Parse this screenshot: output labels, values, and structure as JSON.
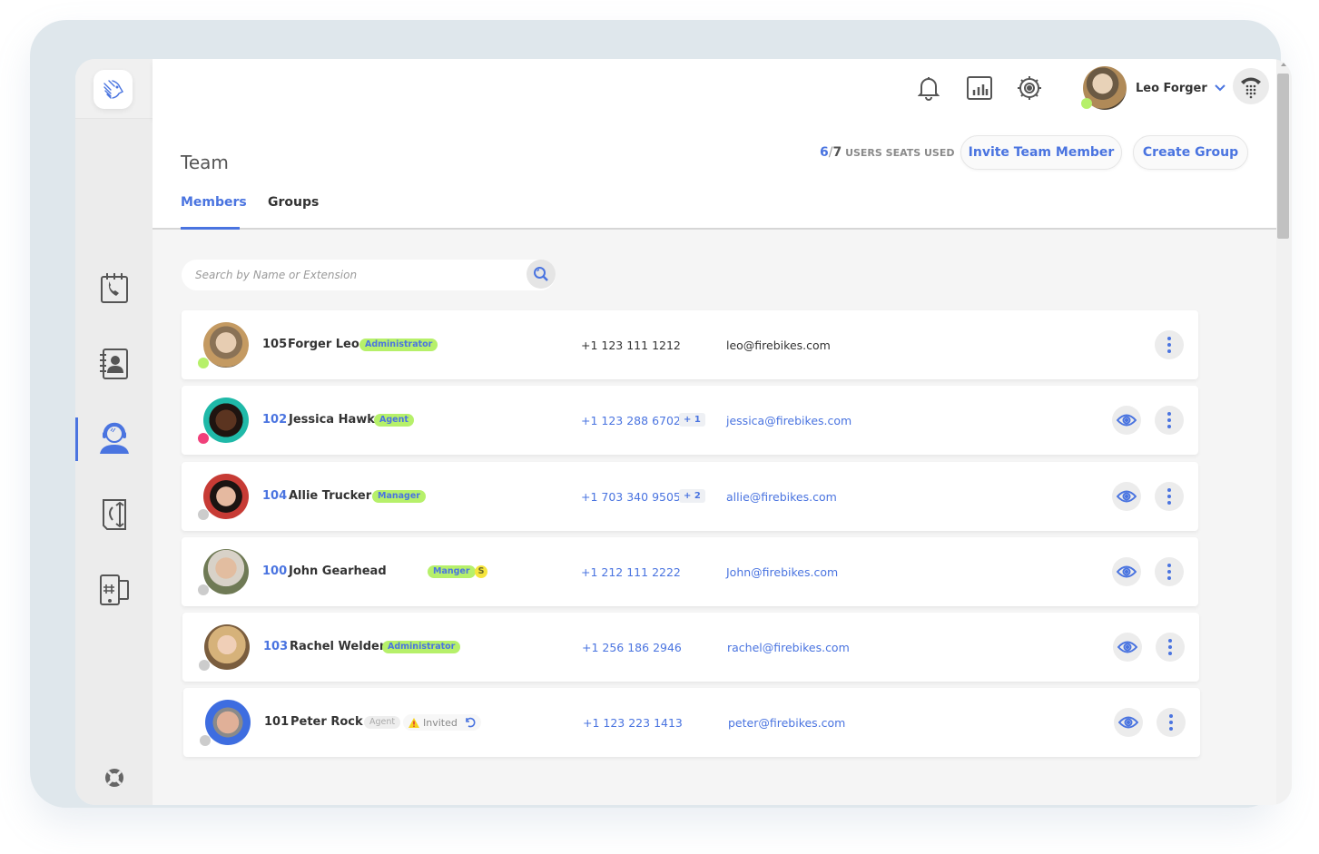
{
  "app": {
    "accent_color": "#4a74e0",
    "logo": "lion-logo-icon"
  },
  "rail": {
    "items": [
      {
        "name": "call-log",
        "icon": "calendar-phone-icon",
        "active": false
      },
      {
        "name": "contacts",
        "icon": "address-book-icon",
        "active": false
      },
      {
        "name": "team",
        "icon": "headset-agent-icon",
        "active": true
      },
      {
        "name": "call-routing",
        "icon": "call-flow-icon",
        "active": false
      },
      {
        "name": "numbers",
        "icon": "phone-number-icon",
        "active": false
      }
    ],
    "help_icon": "lifebuoy-icon"
  },
  "topbar": {
    "icons": [
      "bell-icon",
      "bar-chart-icon",
      "gear-icon"
    ],
    "user_name": "Leo Forger",
    "user_status": "online",
    "dialpad_icon": "dialpad-phone-icon"
  },
  "header": {
    "title": "Team",
    "tabs": [
      {
        "label": "Members",
        "active": true
      },
      {
        "label": "Groups",
        "active": false
      }
    ],
    "seats_used": "6",
    "seats_sep": "/",
    "seats_total": "7",
    "seats_label": "USERS SEATS USED",
    "invite_button": "Invite Team Member",
    "create_group_button": "Create Group"
  },
  "search": {
    "placeholder": "Search by Name or Extension",
    "value": ""
  },
  "members": [
    {
      "ext": "105",
      "name": "Forger Leo",
      "role": "Administrator",
      "status": "online",
      "status_color": "#b6f06a",
      "phone": "+1 123 111 1212",
      "extra_phones": "",
      "email": "leo@firebikes.com",
      "is_self": true,
      "has_view": false,
      "s_badge": "",
      "invited": ""
    },
    {
      "ext": "102",
      "name": "Jessica Hawk",
      "role": "Agent",
      "status": "busy",
      "status_color": "#f0407a",
      "phone": "+1 123 288 6702",
      "extra_phones": "+ 1",
      "email": "jessica@firebikes.com",
      "is_self": false,
      "has_view": true,
      "s_badge": "",
      "invited": ""
    },
    {
      "ext": "104",
      "name": "Allie Trucker",
      "role": "Manager",
      "status": "offline",
      "status_color": "#cccccc",
      "phone": "+1 703 340 9505",
      "extra_phones": "+ 2",
      "email": "allie@firebikes.com",
      "is_self": false,
      "has_view": true,
      "s_badge": "",
      "invited": ""
    },
    {
      "ext": "100",
      "name": "John Gearhead",
      "role": "Manger",
      "status": "offline",
      "status_color": "#cccccc",
      "phone": "+1 212 111 2222",
      "extra_phones": "",
      "email": "John@firebikes.com",
      "is_self": false,
      "has_view": true,
      "s_badge": "S",
      "invited": ""
    },
    {
      "ext": "103",
      "name": "Rachel Welder",
      "role": "Administrator",
      "status": "offline",
      "status_color": "#cccccc",
      "phone": "+1 256 186 2946",
      "extra_phones": "",
      "email": "rachel@firebikes.com",
      "is_self": false,
      "has_view": true,
      "s_badge": "",
      "invited": ""
    },
    {
      "ext": "101",
      "name": "Peter Rock",
      "role": "Agent",
      "status": "offline",
      "status_color": "#cccccc",
      "phone": "+1 123 223 1413",
      "extra_phones": "",
      "email": "peter@firebikes.com",
      "is_self": false,
      "has_view": true,
      "s_badge": "",
      "invited": "Invited",
      "role_muted": true
    }
  ]
}
